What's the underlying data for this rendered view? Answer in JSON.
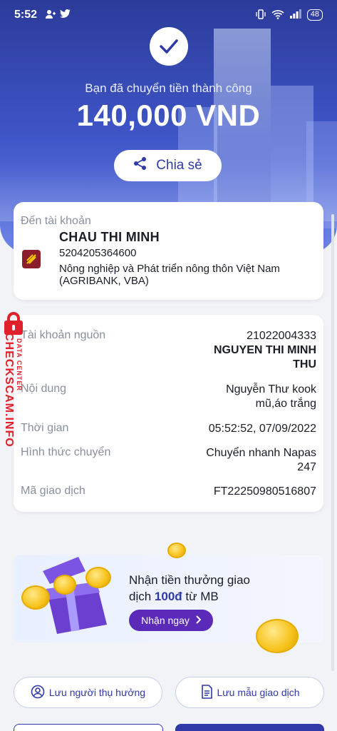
{
  "status_bar": {
    "time": "5:52",
    "battery": "48"
  },
  "header": {
    "success_message": "Bạn đã chuyển tiền thành công",
    "amount": "140,000 VND",
    "share_label": "Chia sẻ"
  },
  "recipient": {
    "label": "Đến tài khoản",
    "name": "CHAU THI MINH",
    "account_number": "5204205364600",
    "bank_name": "Nông nghiệp và Phát triển nông thôn Việt Nam (AGRIBANK, VBA)"
  },
  "details": {
    "source_label": "Tài khoản nguồn",
    "source_account": "21022004333",
    "source_name": "NGUYEN THI MINH THU",
    "content_label": "Nội dung",
    "content_value": "Nguyễn Thư kook mũ,áo trắng",
    "time_label": "Thời gian",
    "time_value": "05:52:52, 07/09/2022",
    "method_label": "Hình thức chuyển",
    "method_value": "Chuyển nhanh Napas 247",
    "txn_label": "Mã giao dịch",
    "txn_value": "FT22250980516807"
  },
  "watermark": {
    "brand": "CHECKSCAM.INFO",
    "sub": "DATA CENTER"
  },
  "promo": {
    "line1": "Nhận tiền thưởng giao",
    "line2_prefix": "dịch ",
    "line2_highlight": "100đ",
    "line2_suffix": " từ MB",
    "cta": "Nhận ngay"
  },
  "actions": {
    "save_beneficiary": "Lưu người thụ hưởng",
    "save_template": "Lưu mẫu giao dịch"
  },
  "colors": {
    "brand": "#2f3aa8",
    "promo_button": "#5b2ab8",
    "watermark": "#e0202a"
  }
}
